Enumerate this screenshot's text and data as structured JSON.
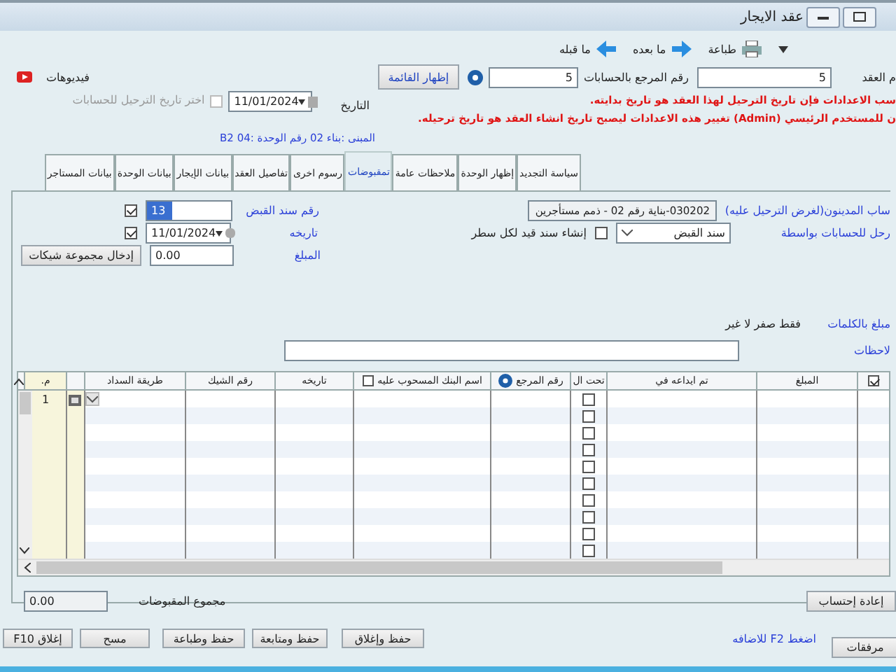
{
  "window": {
    "title": "عقد الايجار"
  },
  "toolbar": [
    {
      "kind": "print",
      "label": "طباعة"
    },
    {
      "kind": "next",
      "label": "ما بعده"
    },
    {
      "kind": "prev",
      "label": "ما قبله"
    }
  ],
  "header": {
    "contract_label": "م العقد",
    "contract_value": "5",
    "ref_label": "رقم المرجع بالحسابات",
    "ref_value": "5",
    "show_list_button": "إظهار القائمة",
    "videos_label": "فيديوهات",
    "date_label": "التاريخ",
    "date_value": "11/01/2024",
    "posting_date_label": "اختر تاريخ الترحيل للحسابات",
    "posting_date_checked": false,
    "posting_date_disabled": true,
    "warnings": [
      "سب الاعدادات فإن تاريخ الترحيل لهذا العقد هو تاريخ بدايته.",
      "ن للمستخدم الرئيسي (Admin) تغيير هذه الاعدادات ليصبح تاريخ انشاء العقد هو تاريخ ترحيله."
    ],
    "unit_info": "المبنى :بناء 02 رقم الوحدة :04 B2"
  },
  "tabs": [
    {
      "label": "سياسة التجديد",
      "selected": false
    },
    {
      "label": "إظهار الوحدة",
      "selected": false
    },
    {
      "label": "ملاحظات عامة",
      "selected": false
    },
    {
      "label": "تمقبوضات",
      "selected": true
    },
    {
      "label": "رسوم اخرى",
      "selected": false
    },
    {
      "label": "تفاصيل العقد",
      "selected": false
    },
    {
      "label": "بيانات الإيجار",
      "selected": false
    },
    {
      "label": "بيانات الوحدة",
      "selected": false
    },
    {
      "label": "بيانات المستاجر",
      "selected": false
    }
  ],
  "receipts": {
    "debtor_label": "ساب المدينون(لغرض الترحيل عليه)",
    "debtor_value": "030202-بناية رقم 02 - ذمم مستأجرين",
    "post_via_label": "رحل للحسابات بواسطة",
    "post_via_value": "سند القبض",
    "entry_per_line_label": "إنشاء سند قيد لكل سطر",
    "entry_per_line_checked": false,
    "voucher_label": "رقم سند القبض",
    "voucher_value": "13",
    "voucher_checked": true,
    "voucher_date_label": "تاريخه",
    "voucher_date_value": "11/01/2024",
    "voucher_date_checked": true,
    "amount_label": "المبلغ",
    "amount_value": "0.00",
    "cheques_button": "إدخال مجموعة شيكات",
    "words_label": "مبلغ بالكلمات",
    "words_value": "فقط صفر لا غير",
    "notes_label": "لاحظات"
  },
  "grid": {
    "select_all_checked": true,
    "columns": [
      {
        "label": "المبلغ",
        "kind": "text"
      },
      {
        "label": "تم ايداعه في",
        "kind": "text"
      },
      {
        "label": "تحت ال",
        "kind": "text"
      },
      {
        "label": "رقم المرجع",
        "kind": "help"
      },
      {
        "label": "اسم البنك المسحوب عليه",
        "kind": "checkbox",
        "checked": false
      },
      {
        "label": "تاريخه",
        "kind": "text"
      },
      {
        "label": "رقم الشيك",
        "kind": "text"
      },
      {
        "label": "طريقة السداد",
        "kind": "text"
      }
    ],
    "number_header": "م.",
    "rows": [
      {
        "number": "1",
        "current": true,
        "checked": false
      },
      {
        "current": false,
        "checked": false
      },
      {
        "current": false,
        "checked": false
      },
      {
        "current": false,
        "checked": false
      },
      {
        "current": false,
        "checked": false
      },
      {
        "current": false,
        "checked": false
      },
      {
        "current": false,
        "checked": false
      },
      {
        "current": false,
        "checked": false
      },
      {
        "current": false,
        "checked": false
      },
      {
        "current": false,
        "checked": false
      }
    ]
  },
  "totals": {
    "recalc_button": "إعادة إحتساب",
    "total_label": "مجموع المقبوضات",
    "total_value": "0.00"
  },
  "footer": {
    "attachments_button": "مرفقات",
    "hint": "اضغط F2 للاضافه",
    "buttons": [
      "حفظ وإغلاق",
      "حفظ ومتابعة",
      "حفظ وطباعة",
      "مسح",
      "إغلاق F10"
    ]
  }
}
